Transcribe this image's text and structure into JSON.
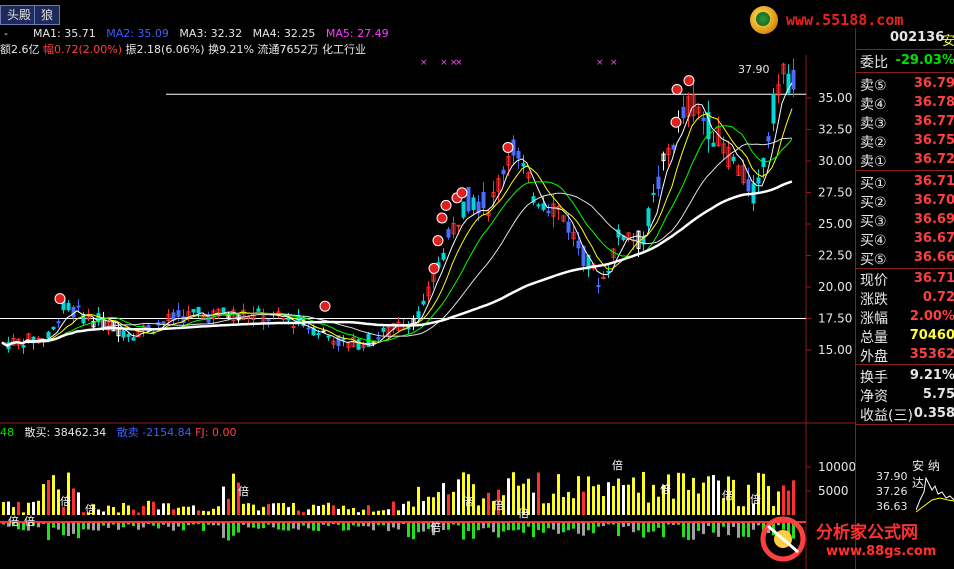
{
  "tabs": [
    {
      "label": "头殿"
    },
    {
      "label": "狼"
    }
  ],
  "logo": {
    "text": "www.55188.com"
  },
  "info_line1": {
    "lead": "-",
    "ma1": "MA1: 35.71",
    "ma2": "MA2: 35.09",
    "ma3": "MA3: 32.32",
    "ma4": "MA4: 32.25",
    "ma5": "MA5: 27.49"
  },
  "info_line2": {
    "amount": "额2.6亿",
    "change_label": "幅",
    "change_value": "0.72(2.00%)",
    "amplitude": "振2.18(6.06%)",
    "turnover": "换9.21%",
    "float": "流通7652万",
    "industry": "化工行业"
  },
  "price_axis": [
    "35.00",
    "32.50",
    "30.00",
    "27.50",
    "25.00",
    "22.50",
    "20.00",
    "17.50",
    "15.00"
  ],
  "high_label": "37.90",
  "sub_indicator": {
    "prefix": "48",
    "retail_buy": "散买: 38462.34",
    "retail_sell_label": "散卖",
    "retail_sell_value": "-2154.84",
    "fj": "FJ: 0.00"
  },
  "volume_axis": [
    "10000",
    "5000"
  ],
  "volume_markers": [
    "倍",
    "倍",
    "倍",
    "倍",
    "倍",
    "倍",
    "倍",
    "倍",
    "倍",
    "倍",
    "倍",
    "倍",
    "倍"
  ],
  "quote": {
    "code": "002136",
    "name_fragment": "安",
    "weibi_label": "委比",
    "weibi_value": "-29.03%",
    "sells": [
      {
        "label": "卖⑤",
        "price": "36.79"
      },
      {
        "label": "卖④",
        "price": "36.78"
      },
      {
        "label": "卖③",
        "price": "36.77"
      },
      {
        "label": "卖②",
        "price": "36.75"
      },
      {
        "label": "卖①",
        "price": "36.72"
      }
    ],
    "buys": [
      {
        "label": "买①",
        "price": "36.71"
      },
      {
        "label": "买②",
        "price": "36.70"
      },
      {
        "label": "买③",
        "price": "36.69"
      },
      {
        "label": "买④",
        "price": "36.67"
      },
      {
        "label": "买⑤",
        "price": "36.66"
      }
    ],
    "stats": [
      {
        "label": "现价",
        "value": "36.71",
        "color": "#ff4040"
      },
      {
        "label": "涨跌",
        "value": "0.72",
        "color": "#ff4040"
      },
      {
        "label": "涨幅",
        "value": "2.00%",
        "color": "#ff4040"
      },
      {
        "label": "总量",
        "value": "70460",
        "color": "#ffff40"
      },
      {
        "label": "外盘",
        "value": "35362",
        "color": "#ff4040"
      }
    ],
    "stats2": [
      {
        "label": "换手",
        "value": "9.21%",
        "color": "#e6e6e6"
      },
      {
        "label": "净资",
        "value": "5.75",
        "color": "#e6e6e6"
      },
      {
        "label": "收益(三)",
        "value": "0.358",
        "color": "#e6e6e6"
      }
    ],
    "mini_title": "安 纳 达",
    "mini_prices": [
      "37.90",
      "37.26",
      "36.63"
    ]
  },
  "watermark": {
    "title": "分析家公式网",
    "url": "www.88gs.com"
  },
  "colors": {
    "up": "#ff3030",
    "down": "#00d8d8",
    "ma_white": "#ffffff",
    "ma_yellow": "#ffff00",
    "ma_magenta": "#ff00ff",
    "ma_green": "#00ff00",
    "grid_red": "#8b1c1c"
  }
}
